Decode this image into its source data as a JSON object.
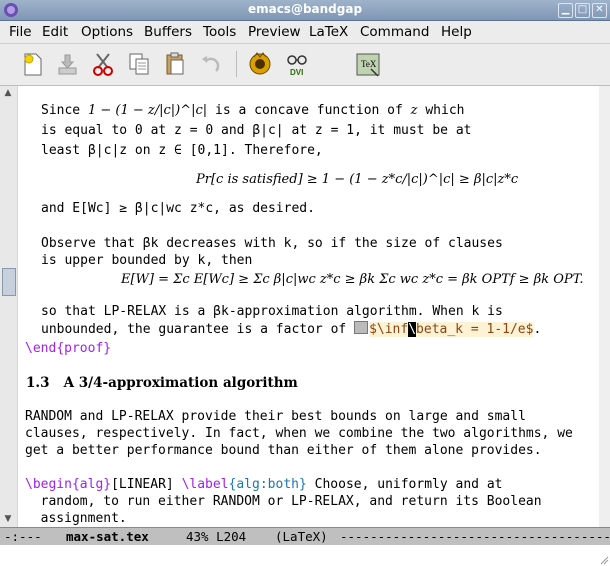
{
  "window": {
    "title": "emacs@bandgap"
  },
  "menu": [
    "File",
    "Edit",
    "Options",
    "Buffers",
    "Tools",
    "Preview",
    "LaTeX",
    "Command",
    "Help"
  ],
  "toolbar": {
    "tools": [
      "new-file-icon",
      "save-icon",
      "cut-icon",
      "copy-icon",
      "paste-icon",
      "undo-icon",
      "latex-icon",
      "dvi-icon",
      "tex-icon"
    ]
  },
  "editor": {
    "p1_l1a": "Since ",
    "p1_l1m": "1 − (1 − z/|c|)^|c|",
    "p1_l1b": " is a concave function of ",
    "p1_l1z": "z",
    "p1_l1c": " which",
    "p1_l2": "is equal to 0 at z = 0 and β|c| at z = 1, it must be at",
    "p1_l3": "least β|c|z on z ∈ [0,1]. Therefore,",
    "eq1": "Pr[c is satisfied] ≥ 1 − (1 − z*c/|c|)^|c| ≥ β|c|z*c",
    "p1_l4": "and E[Wc] ≥ β|c|wc z*c, as desired.",
    "p2_l1": "Observe that βk decreases with k, so if the size of clauses",
    "p2_l2": "is upper bounded by k, then",
    "eq2": "E[W] = Σc E[Wc] ≥ Σc β|c|wc z*c ≥ βk Σc wc z*c = βk OPTf ≥ βk OPT.",
    "p2_l3": "so that LP-RELAX is a βk-approximation algorithm. When k is",
    "p2_l4a": "unbounded, the guarantee is a factor of ",
    "p2_l4b": "$\\inf",
    "p2_l4cur": "\\",
    "p2_l4c": "beta_k = 1-1/e$",
    "p2_l4d": ".",
    "end_cmd": "\\end",
    "end_arg": "{proof}",
    "section_num": "1.3",
    "section_title": "A 3/4-approximation algorithm",
    "p3_l1": "RANDOM and LP-RELAX provide their best bounds on large and small",
    "p3_l2": "clauses, respectively. In fact, when we combine the two algorithms, we",
    "p3_l3": "get a better performance bound than either of them alone provides.",
    "p4_begin": "\\begin",
    "p4_alg": "{alg}",
    "p4_opt": "[LINEAR] ",
    "p4_label": "\\label",
    "p4_labarg": "{alg:both}",
    "p4_rest": " Choose, uniformly and at",
    "p4_l2": "  random, to run either RANDOM or LP-RELAX, and return its Boolean",
    "p4_l3": "  assignment."
  },
  "modeline": {
    "status": "-:---",
    "buffer": "max-sat.tex",
    "pos": "43% L204",
    "mode": "(LaTeX)",
    "fill": "--------------------------------------------------------------"
  },
  "colors": {
    "keyword": "#a020f0",
    "argument": "#1a7aaa",
    "preview": "#fdf2d3"
  }
}
